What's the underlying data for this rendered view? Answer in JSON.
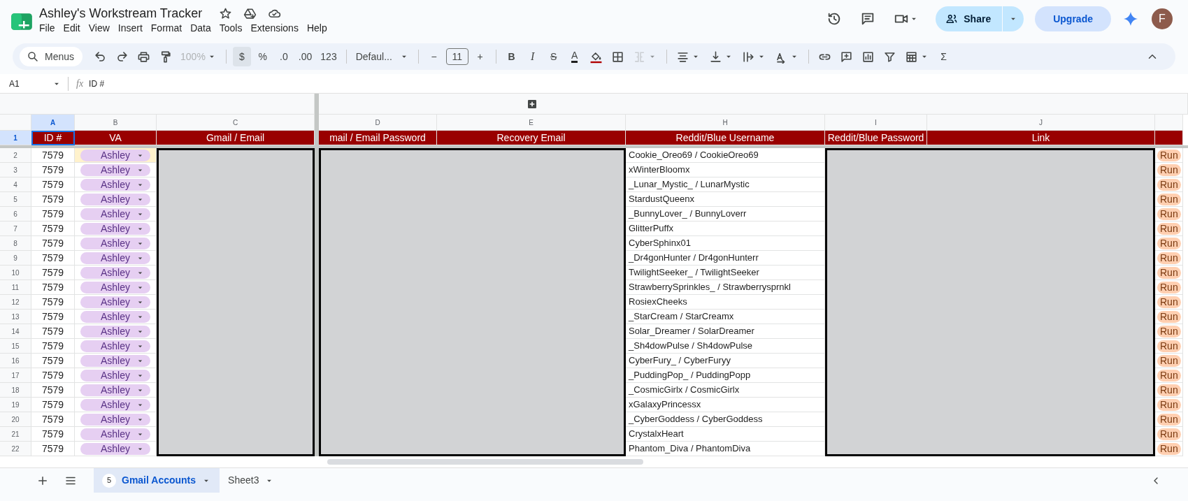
{
  "app": {
    "title": "Ashley's Workstream Tracker",
    "menus": [
      "File",
      "Edit",
      "View",
      "Insert",
      "Format",
      "Data",
      "Tools",
      "Extensions",
      "Help"
    ],
    "share": "Share",
    "upgrade": "Upgrade",
    "avatar": "F"
  },
  "toolbar": {
    "search": "Menus",
    "items": [
      {
        "kind": "undo"
      },
      {
        "kind": "redo"
      },
      {
        "kind": "print"
      },
      {
        "kind": "paint"
      },
      {
        "kind": "text",
        "label": "100%",
        "caret": true,
        "disabled": true
      },
      {
        "kind": "separator"
      },
      {
        "kind": "text",
        "label": "$",
        "selected": true
      },
      {
        "kind": "text",
        "label": "%"
      },
      {
        "kind": "text",
        "label": ".0"
      },
      {
        "kind": "text",
        "label": ".00"
      },
      {
        "kind": "text",
        "label": "123"
      },
      {
        "kind": "separator"
      },
      {
        "kind": "text",
        "label": "Defaul...",
        "caret": true
      },
      {
        "kind": "separator"
      },
      {
        "kind": "text",
        "label": "−"
      },
      {
        "kind": "fontsize",
        "label": "11"
      },
      {
        "kind": "text",
        "label": "+"
      },
      {
        "kind": "separator"
      },
      {
        "kind": "bold",
        "label": "B"
      },
      {
        "kind": "italic",
        "label": "I"
      },
      {
        "kind": "strike",
        "label": "S"
      },
      {
        "kind": "textcolor",
        "label": "A"
      },
      {
        "kind": "fill"
      },
      {
        "kind": "borders"
      },
      {
        "kind": "merge",
        "caret": true,
        "disabled": true
      },
      {
        "kind": "separator"
      },
      {
        "kind": "align",
        "caret": true
      },
      {
        "kind": "valign",
        "caret": true
      },
      {
        "kind": "wrap",
        "caret": true
      },
      {
        "kind": "rotate",
        "caret": true
      },
      {
        "kind": "separator"
      },
      {
        "kind": "link"
      },
      {
        "kind": "comment"
      },
      {
        "kind": "chart"
      },
      {
        "kind": "filter"
      },
      {
        "kind": "functions",
        "caret": true
      },
      {
        "kind": "text",
        "label": "Σ"
      }
    ]
  },
  "formula_bar": {
    "cell": "A1",
    "fx": "fx",
    "value": "ID #"
  },
  "columns": [
    {
      "letter": "A",
      "header": "ID #",
      "kind": "number",
      "frozen": true,
      "selected": true,
      "redacted": false
    },
    {
      "letter": "B",
      "header": "VA",
      "kind": "chip",
      "frozen": true,
      "selected": false,
      "redacted": false
    },
    {
      "letter": "C",
      "header": "Gmail / Email",
      "kind": "blank",
      "frozen": true,
      "selected": false,
      "redacted": true
    },
    {
      "letter": "D",
      "header": "mail / Email Password",
      "kind": "blank",
      "frozen": false,
      "selected": false,
      "redacted": true
    },
    {
      "letter": "E",
      "header": "Recovery Email",
      "kind": "blank",
      "frozen": false,
      "selected": false,
      "redacted": true
    },
    {
      "letter": "H",
      "header": "Reddit/Blue Username",
      "kind": "text",
      "frozen": false,
      "selected": false,
      "redacted": false
    },
    {
      "letter": "I",
      "header": "Reddit/Blue Password",
      "kind": "blank",
      "frozen": false,
      "selected": false,
      "redacted": true
    },
    {
      "letter": "J",
      "header": "Link",
      "kind": "blank",
      "frozen": false,
      "selected": false,
      "redacted": true
    }
  ],
  "header_row": "1",
  "rows": [
    {
      "number": "2",
      "id": "7579",
      "va": "Ashley",
      "username": "Cookie_Oreo69 / CookieOreo69",
      "status": "Run",
      "highlighted": true
    },
    {
      "number": "3",
      "id": "7579",
      "va": "Ashley",
      "username": "xWinterBloomx",
      "status": "Run",
      "highlighted": false
    },
    {
      "number": "4",
      "id": "7579",
      "va": "Ashley",
      "username": "_Lunar_Mystic_ / LunarMystic",
      "status": "Run",
      "highlighted": false
    },
    {
      "number": "5",
      "id": "7579",
      "va": "Ashley",
      "username": "StardustQueenx",
      "status": "Run",
      "highlighted": false
    },
    {
      "number": "6",
      "id": "7579",
      "va": "Ashley",
      "username": "_BunnyLover_ / BunnyLoverr",
      "status": "Run",
      "highlighted": false
    },
    {
      "number": "7",
      "id": "7579",
      "va": "Ashley",
      "username": "GlitterPuffx",
      "status": "Run",
      "highlighted": false
    },
    {
      "number": "8",
      "id": "7579",
      "va": "Ashley",
      "username": "CyberSphinx01",
      "status": "Run",
      "highlighted": false
    },
    {
      "number": "9",
      "id": "7579",
      "va": "Ashley",
      "username": "_Dr4gonHunter / Dr4gonHunterr",
      "status": "Run",
      "highlighted": false
    },
    {
      "number": "10",
      "id": "7579",
      "va": "Ashley",
      "username": "TwilightSeeker_ / TwilightSeeker",
      "status": "Run",
      "highlighted": false
    },
    {
      "number": "11",
      "id": "7579",
      "va": "Ashley",
      "username": "StrawberrySprinkles_ / Strawberrysprnkl",
      "status": "Run",
      "highlighted": false
    },
    {
      "number": "12",
      "id": "7579",
      "va": "Ashley",
      "username": "RosiexCheeks",
      "status": "Run",
      "highlighted": false
    },
    {
      "number": "13",
      "id": "7579",
      "va": "Ashley",
      "username": "_StarCream / StarCreamx",
      "status": "Run",
      "highlighted": false
    },
    {
      "number": "14",
      "id": "7579",
      "va": "Ashley",
      "username": "Solar_Dreamer / SolarDreamer",
      "status": "Run",
      "highlighted": false
    },
    {
      "number": "15",
      "id": "7579",
      "va": "Ashley",
      "username": "_Sh4dowPulse / Sh4dowPulse",
      "status": "Run",
      "highlighted": false
    },
    {
      "number": "16",
      "id": "7579",
      "va": "Ashley",
      "username": "CyberFury_ / CyberFuryy",
      "status": "Run",
      "highlighted": false
    },
    {
      "number": "17",
      "id": "7579",
      "va": "Ashley",
      "username": "_PuddingPop_ / PuddingPopp",
      "status": "Run",
      "highlighted": false
    },
    {
      "number": "18",
      "id": "7579",
      "va": "Ashley",
      "username": "_CosmicGirlx / CosmicGirlx",
      "status": "Run",
      "highlighted": false
    },
    {
      "number": "19",
      "id": "7579",
      "va": "Ashley",
      "username": "xGalaxyPrincessx",
      "status": "Run",
      "highlighted": false
    },
    {
      "number": "20",
      "id": "7579",
      "va": "Ashley",
      "username": "_CyberGoddess / CyberGoddess",
      "status": "Run",
      "highlighted": false
    },
    {
      "number": "21",
      "id": "7579",
      "va": "Ashley",
      "username": "CrystalxHeart",
      "status": "Run",
      "highlighted": false
    },
    {
      "number": "22",
      "id": "7579",
      "va": "Ashley",
      "username": "Phantom_Diva / PhantomDiva",
      "status": "Run",
      "highlighted": false
    }
  ],
  "sheets": [
    {
      "name": "Gmail Accounts",
      "badge": "5",
      "selected": true
    },
    {
      "name": "Sheet3",
      "selected": false
    }
  ]
}
